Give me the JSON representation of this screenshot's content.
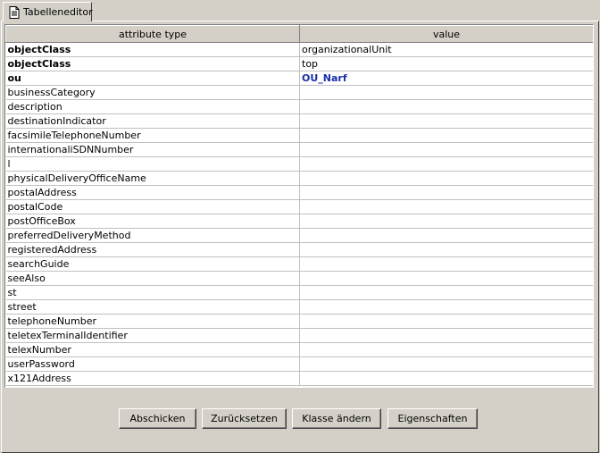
{
  "tab": {
    "label": "Tabelleneditor",
    "icon": "document-icon"
  },
  "table": {
    "headers": {
      "attribute": "attribute type",
      "value": "value"
    },
    "rows": [
      {
        "attr": "objectClass",
        "value": "organizationalUnit",
        "bold": true
      },
      {
        "attr": "objectClass",
        "value": "top",
        "bold": true
      },
      {
        "attr": "ou",
        "value": "OU_Narf",
        "bold": true,
        "highlight": true
      },
      {
        "attr": "businessCategory",
        "value": ""
      },
      {
        "attr": "description",
        "value": ""
      },
      {
        "attr": "destinationIndicator",
        "value": ""
      },
      {
        "attr": "facsimileTelephoneNumber",
        "value": ""
      },
      {
        "attr": "internationaliSDNNumber",
        "value": ""
      },
      {
        "attr": "l",
        "value": ""
      },
      {
        "attr": "physicalDeliveryOfficeName",
        "value": ""
      },
      {
        "attr": "postalAddress",
        "value": ""
      },
      {
        "attr": "postalCode",
        "value": ""
      },
      {
        "attr": "postOfficeBox",
        "value": ""
      },
      {
        "attr": "preferredDeliveryMethod",
        "value": ""
      },
      {
        "attr": "registeredAddress",
        "value": ""
      },
      {
        "attr": "searchGuide",
        "value": ""
      },
      {
        "attr": "seeAlso",
        "value": ""
      },
      {
        "attr": "st",
        "value": ""
      },
      {
        "attr": "street",
        "value": ""
      },
      {
        "attr": "telephoneNumber",
        "value": ""
      },
      {
        "attr": "teletexTerminalIdentifier",
        "value": ""
      },
      {
        "attr": "telexNumber",
        "value": ""
      },
      {
        "attr": "userPassword",
        "value": ""
      },
      {
        "attr": "x121Address",
        "value": ""
      }
    ]
  },
  "buttons": {
    "submit": "Abschicken",
    "reset": "Zurücksetzen",
    "change_class": "Klasse ändern",
    "properties": "Eigenschaften"
  },
  "colors": {
    "highlight_value": "#1a2ea8",
    "background": "#d4d0c8"
  }
}
